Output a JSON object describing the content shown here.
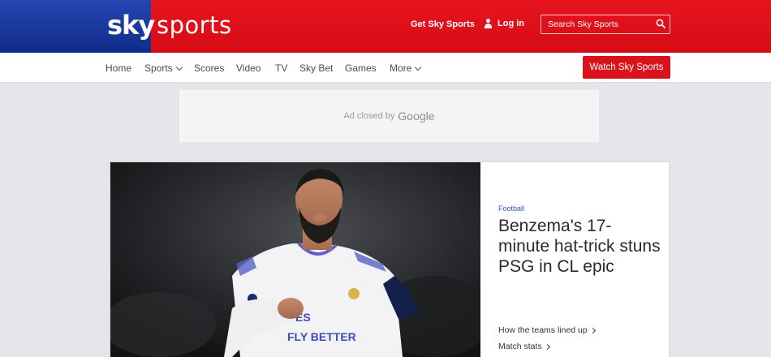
{
  "header": {
    "logo_sky": "sky",
    "logo_sports": "sports",
    "get_sky_sports": "Get Sky Sports",
    "login": "Log in",
    "search_placeholder": "Search Sky Sports"
  },
  "nav": {
    "items": [
      {
        "label": "Home",
        "dropdown": false
      },
      {
        "label": "Sports",
        "dropdown": true
      },
      {
        "label": "Scores",
        "dropdown": false
      },
      {
        "label": "Video",
        "dropdown": false
      },
      {
        "label": "TV",
        "dropdown": false
      },
      {
        "label": "Sky Bet",
        "dropdown": false
      },
      {
        "label": "Games",
        "dropdown": false
      },
      {
        "label": "More",
        "dropdown": true
      }
    ],
    "watch_button": "Watch Sky Sports"
  },
  "ad": {
    "text": "Ad closed by",
    "brand": "Google"
  },
  "hero": {
    "category": "Football",
    "headline": "Benzema's 17-minute hat-trick stuns PSG in CL epic",
    "related": [
      "How the teams lined up",
      "Match stats"
    ],
    "shirt_text": "FLY BETTER"
  },
  "colors": {
    "sky_blue": "#1b3fa8",
    "sky_red": "#e0111b",
    "link_blue": "#2a56c6"
  }
}
